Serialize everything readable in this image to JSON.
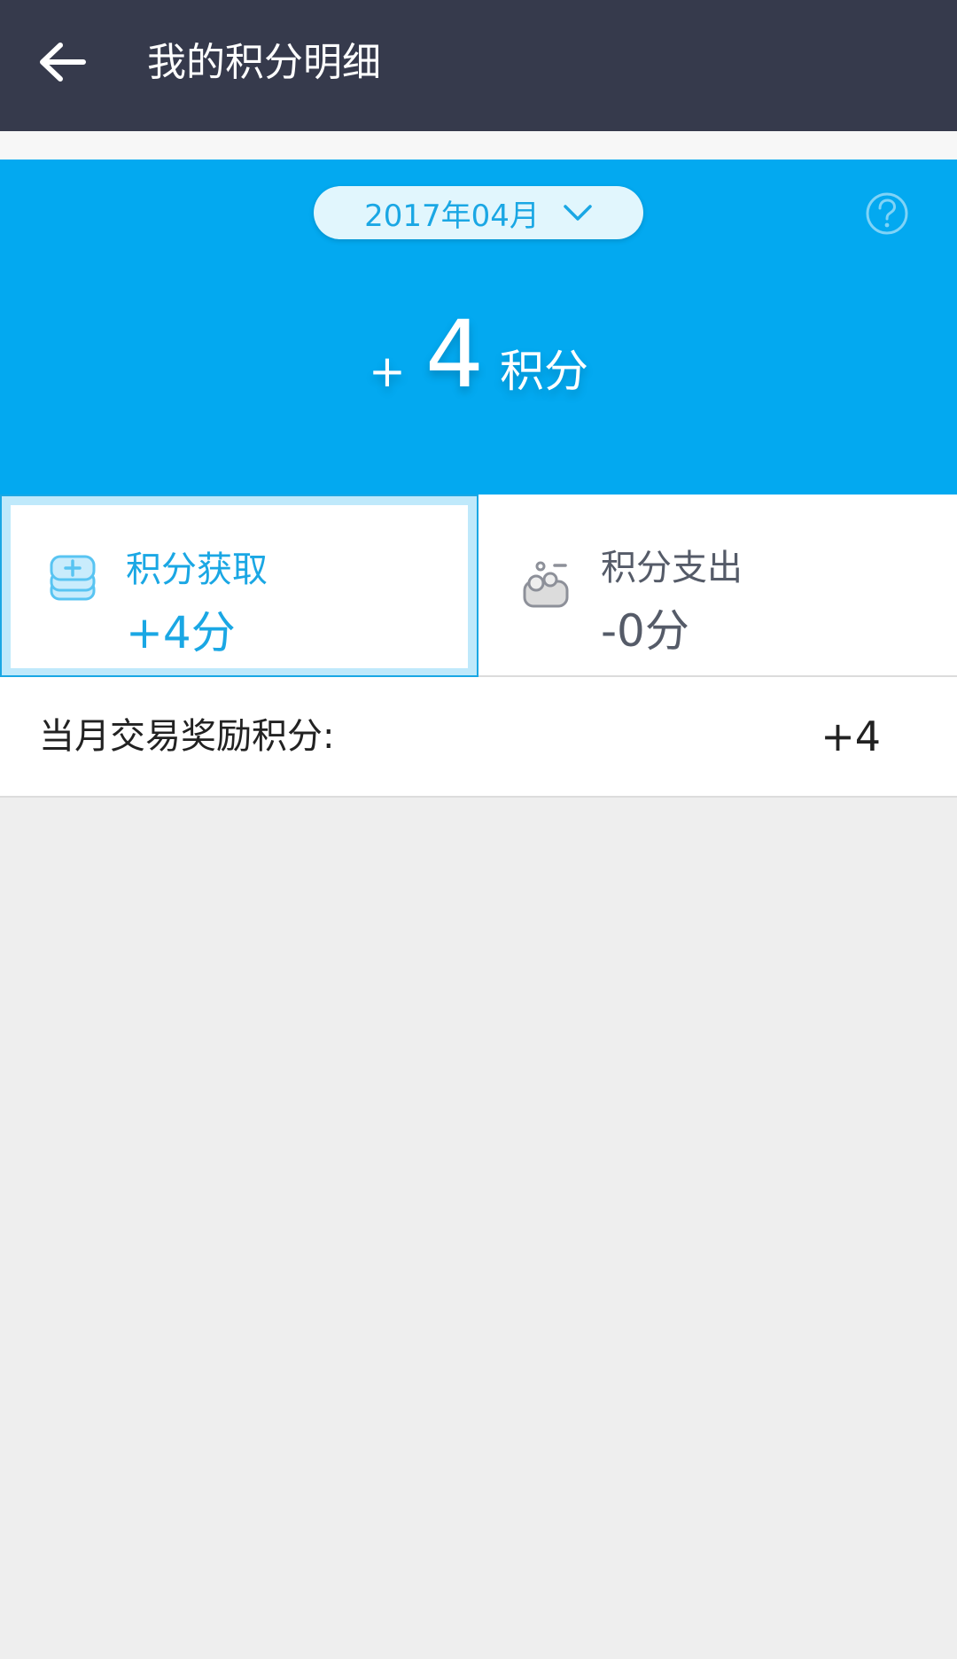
{
  "header": {
    "title": "我的积分明细",
    "back_icon": "arrow-left-icon"
  },
  "summary": {
    "month": "2017年04月",
    "dropdown_icon": "chevron-down-icon",
    "help_icon": "question-circle-icon",
    "sign": "+",
    "total": "4",
    "unit": "积分"
  },
  "cards": {
    "earn": {
      "label": "积分获取",
      "value": "+4分",
      "icon": "stack-plus-icon",
      "selected": true
    },
    "spend": {
      "label": "积分支出",
      "value": "-0分",
      "icon": "stack-minus-icon",
      "selected": false
    }
  },
  "reward": {
    "label": "当月交易奖励积分:",
    "value": "+4"
  },
  "colors": {
    "header_bg": "#363a4c",
    "accent": "#03a9f0",
    "earn_text": "#1aa7e4",
    "spend_text": "#555b68"
  }
}
